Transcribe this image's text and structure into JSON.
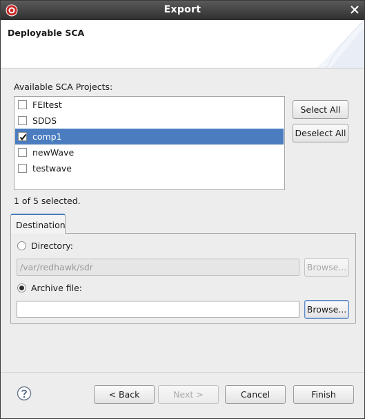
{
  "window": {
    "title": "Export"
  },
  "banner": {
    "heading": "Deployable SCA"
  },
  "projects": {
    "label": "Available SCA Projects:",
    "items": [
      {
        "label": "FEItest",
        "checked": false
      },
      {
        "label": "SDDS",
        "checked": false
      },
      {
        "label": "comp1",
        "checked": true
      },
      {
        "label": "newWave",
        "checked": false
      },
      {
        "label": "testwave",
        "checked": false
      }
    ],
    "select_all": "Select All",
    "deselect_all": "Deselect All",
    "status": "1 of 5 selected."
  },
  "destination": {
    "tab_label": "Destination",
    "directory_label": "Directory:",
    "directory_value": "/var/redhawk/sdr",
    "directory_browse": "Browse...",
    "archive_label": "Archive file:",
    "archive_value": "",
    "archive_browse": "Browse..."
  },
  "footer": {
    "back": "< Back",
    "next": "Next >",
    "cancel": "Cancel",
    "finish": "Finish"
  },
  "colors": {
    "selection": "#4a7cbf",
    "titlebar": "#3c3c3c"
  }
}
